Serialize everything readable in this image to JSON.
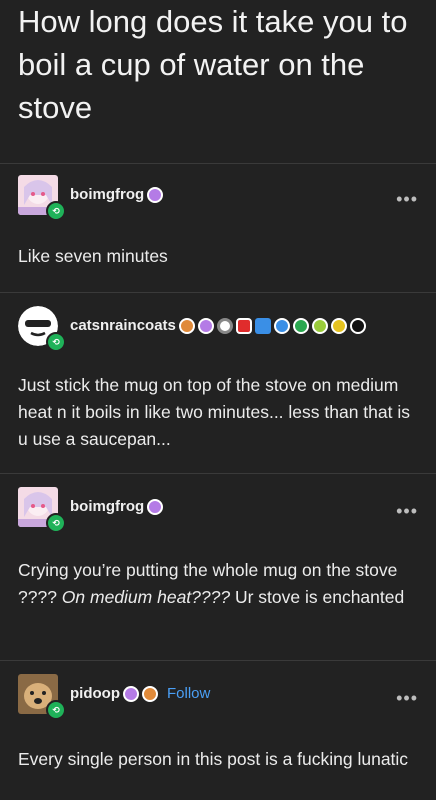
{
  "question": "How long does it take you to boil a cup of water on the stove",
  "posts": [
    {
      "username": "boimgfrog",
      "text": "Like seven minutes"
    },
    {
      "username": "catsnraincoats",
      "text": "Just stick the mug on top of the stove on medium heat n it boils in like two minutes... less than that is u use a saucepan..."
    },
    {
      "username": "boimgfrog",
      "text_part1": "Crying you’re putting the whole mug on the stove ???? ",
      "text_italic": "On medium heat????",
      "text_part2": " Ur stove is enchanted"
    },
    {
      "username": "pidoop",
      "follow_label": "Follow",
      "text": "Every single person in this post is a fucking lunatic"
    }
  ],
  "more_icon": "•••",
  "colors": {
    "background": "#222222",
    "follow": "#4a9ff5",
    "reblog": "#1fb259",
    "purple_badge": "#b47be6"
  }
}
